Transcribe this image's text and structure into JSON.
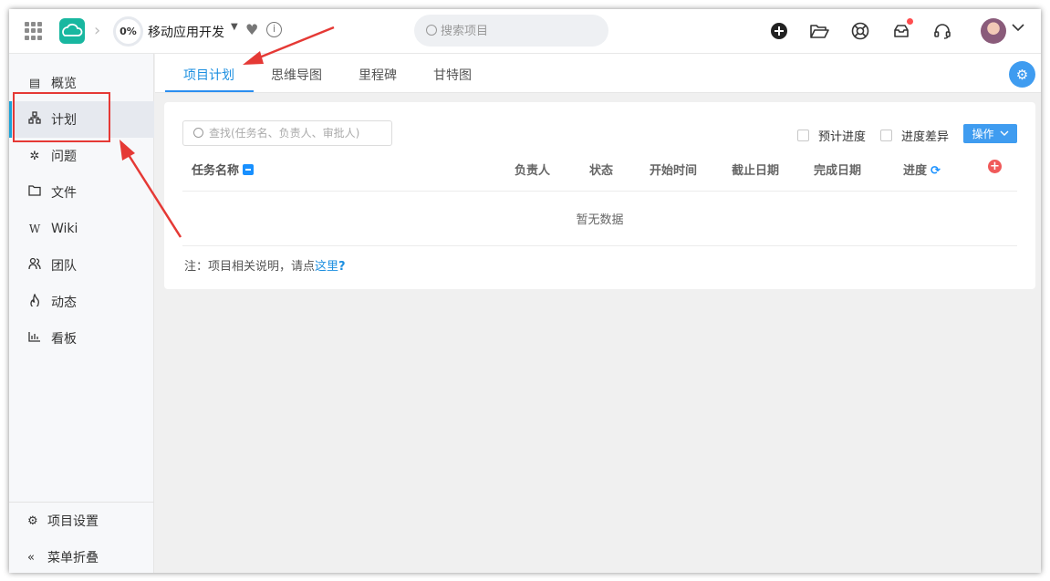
{
  "header": {
    "progress": "0%",
    "project_name": "移动应用开发",
    "search_placeholder": "搜索项目"
  },
  "sidebar": {
    "items": [
      {
        "label": "概览",
        "icon": "overview-icon"
      },
      {
        "label": "计划",
        "icon": "plan-icon"
      },
      {
        "label": "问题",
        "icon": "bug-icon"
      },
      {
        "label": "文件",
        "icon": "folder-icon"
      },
      {
        "label": "Wiki",
        "icon": "wiki-icon"
      },
      {
        "label": "团队",
        "icon": "team-icon"
      },
      {
        "label": "动态",
        "icon": "fire-icon"
      },
      {
        "label": "看板",
        "icon": "chart-icon"
      }
    ],
    "active_index": 1,
    "settings_label": "项目设置",
    "collapse_label": "菜单折叠"
  },
  "tabs": [
    {
      "label": "项目计划"
    },
    {
      "label": "思维导图"
    },
    {
      "label": "里程碑"
    },
    {
      "label": "甘特图"
    }
  ],
  "panel": {
    "search_placeholder": "查找(任务名、负责人、审批人)",
    "checkbox_planned": "预计进度",
    "checkbox_diff": "进度差异",
    "operate_button": "操作",
    "columns": {
      "task_name": "任务名称",
      "owner": "负责人",
      "status": "状态",
      "start": "开始时间",
      "deadline": "截止日期",
      "finish": "完成日期",
      "progress": "进度"
    },
    "empty_text": "暂无数据",
    "note_prefix": "注：项目相关说明，请点",
    "note_link": "这里",
    "note_suffix": "?"
  },
  "colors": {
    "accent": "#1c8fe0",
    "annotation": "#e53935",
    "brand_teal": "#18b7a0"
  }
}
